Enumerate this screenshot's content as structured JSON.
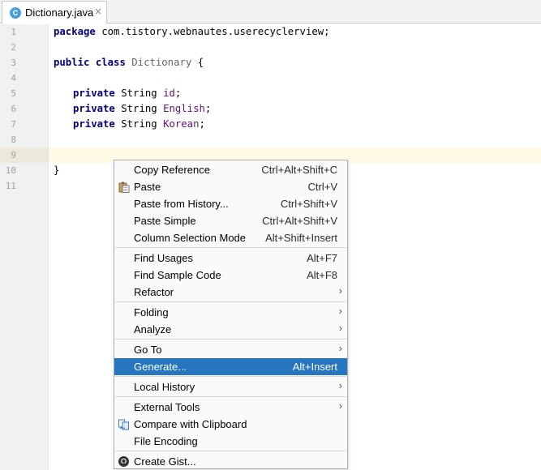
{
  "tab": {
    "icon_letter": "C",
    "label": "Dictionary.java",
    "close": "×"
  },
  "editor": {
    "lines": [
      {
        "num": "1"
      },
      {
        "num": "2"
      },
      {
        "num": "3"
      },
      {
        "num": "4"
      },
      {
        "num": "5"
      },
      {
        "num": "6"
      },
      {
        "num": "7"
      },
      {
        "num": "8"
      },
      {
        "num": "9"
      },
      {
        "num": "10"
      },
      {
        "num": "11"
      }
    ],
    "code": {
      "l1_kw": "package",
      "l1_rest": " com.tistory.webnautes.userecyclerview;",
      "l3_kw1": "public",
      "l3_kw2": "class",
      "l3_name": "Dictionary",
      "l3_rest": " {",
      "l5_kw": "private",
      "l5_type": " String ",
      "l5_field": "id",
      "l5_end": ";",
      "l6_kw": "private",
      "l6_type": " String ",
      "l6_field": "English",
      "l6_end": ";",
      "l7_kw": "private",
      "l7_type": " String ",
      "l7_field": "Korean",
      "l7_end": ";",
      "l10": "}"
    }
  },
  "context_menu": {
    "items": [
      {
        "label": "Copy Reference",
        "shortcut": "Ctrl+Alt+Shift+C"
      },
      {
        "label": "Paste",
        "shortcut": "Ctrl+V",
        "icon": "paste-icon"
      },
      {
        "label": "Paste from History...",
        "shortcut": "Ctrl+Shift+V"
      },
      {
        "label": "Paste Simple",
        "shortcut": "Ctrl+Alt+Shift+V"
      },
      {
        "label": "Column Selection Mode",
        "shortcut": "Alt+Shift+Insert"
      },
      {
        "label": "Find Usages",
        "shortcut": "Alt+F7"
      },
      {
        "label": "Find Sample Code",
        "shortcut": "Alt+F8"
      },
      {
        "label": "Refactor",
        "submenu": "›"
      },
      {
        "label": "Folding",
        "submenu": "›"
      },
      {
        "label": "Analyze",
        "submenu": "›"
      },
      {
        "label": "Go To",
        "submenu": "›"
      },
      {
        "label": "Generate...",
        "shortcut": "Alt+Insert",
        "highlighted": true
      },
      {
        "label": "Local History",
        "submenu": "›"
      },
      {
        "label": "External Tools",
        "submenu": "›"
      },
      {
        "label": "Compare with Clipboard",
        "icon": "compare-icon"
      },
      {
        "label": "File Encoding"
      },
      {
        "label": "Create Gist...",
        "icon": "github-icon"
      }
    ]
  },
  "colors": {
    "keyword": "#000080",
    "field": "#660e7a",
    "menu_highlight": "#2675bf",
    "caret_row": "#fffae3",
    "tab_icon": "#4a9fd8"
  }
}
